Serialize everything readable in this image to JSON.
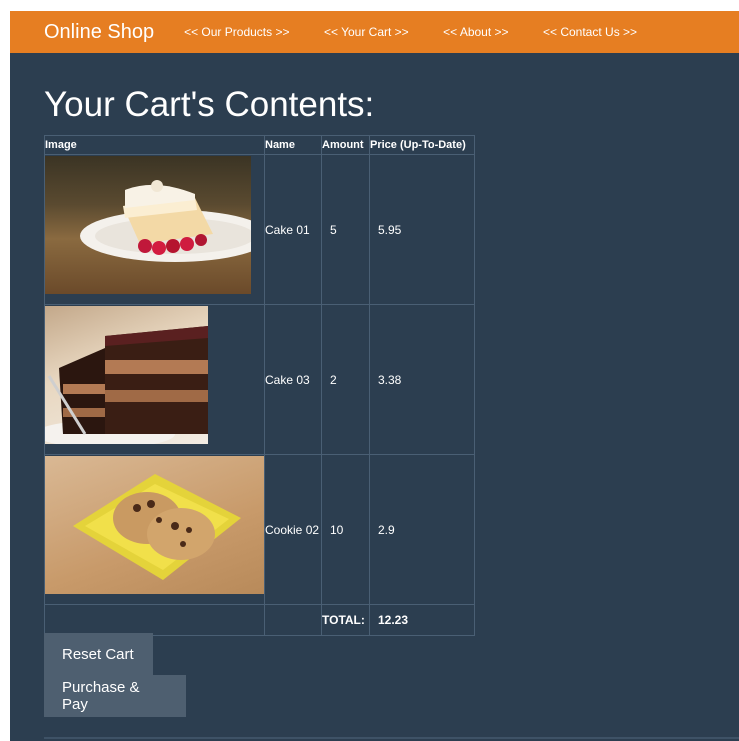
{
  "header": {
    "brand": "Online Shop",
    "nav": [
      {
        "label": "<< Our Products >>"
      },
      {
        "label": "<< Your Cart >>"
      },
      {
        "label": "<< About >>"
      },
      {
        "label": "<< Contact Us >>"
      }
    ]
  },
  "page": {
    "title": "Your Cart's Contents:"
  },
  "table": {
    "headers": [
      "Image",
      "Name",
      "Amount",
      "Price (Up-To-Date)"
    ],
    "rows": [
      {
        "name": "Cake 01",
        "amount": "5",
        "price": "5.95",
        "image_icon": "cake-slice-raspberry-image"
      },
      {
        "name": "Cake 03",
        "amount": "2",
        "price": "3.38",
        "image_icon": "chocolate-cake-slice-image"
      },
      {
        "name": "Cookie 02",
        "amount": "10",
        "price": "2.9",
        "image_icon": "cookies-plate-image"
      }
    ],
    "total_label": "TOTAL:",
    "total_value": "12.23"
  },
  "buttons": {
    "reset": "Reset Cart",
    "purchase": "Purchase & Pay"
  },
  "colors": {
    "topbar": "#e67e22",
    "background": "#2c3e50",
    "button": "#4e5f70"
  }
}
